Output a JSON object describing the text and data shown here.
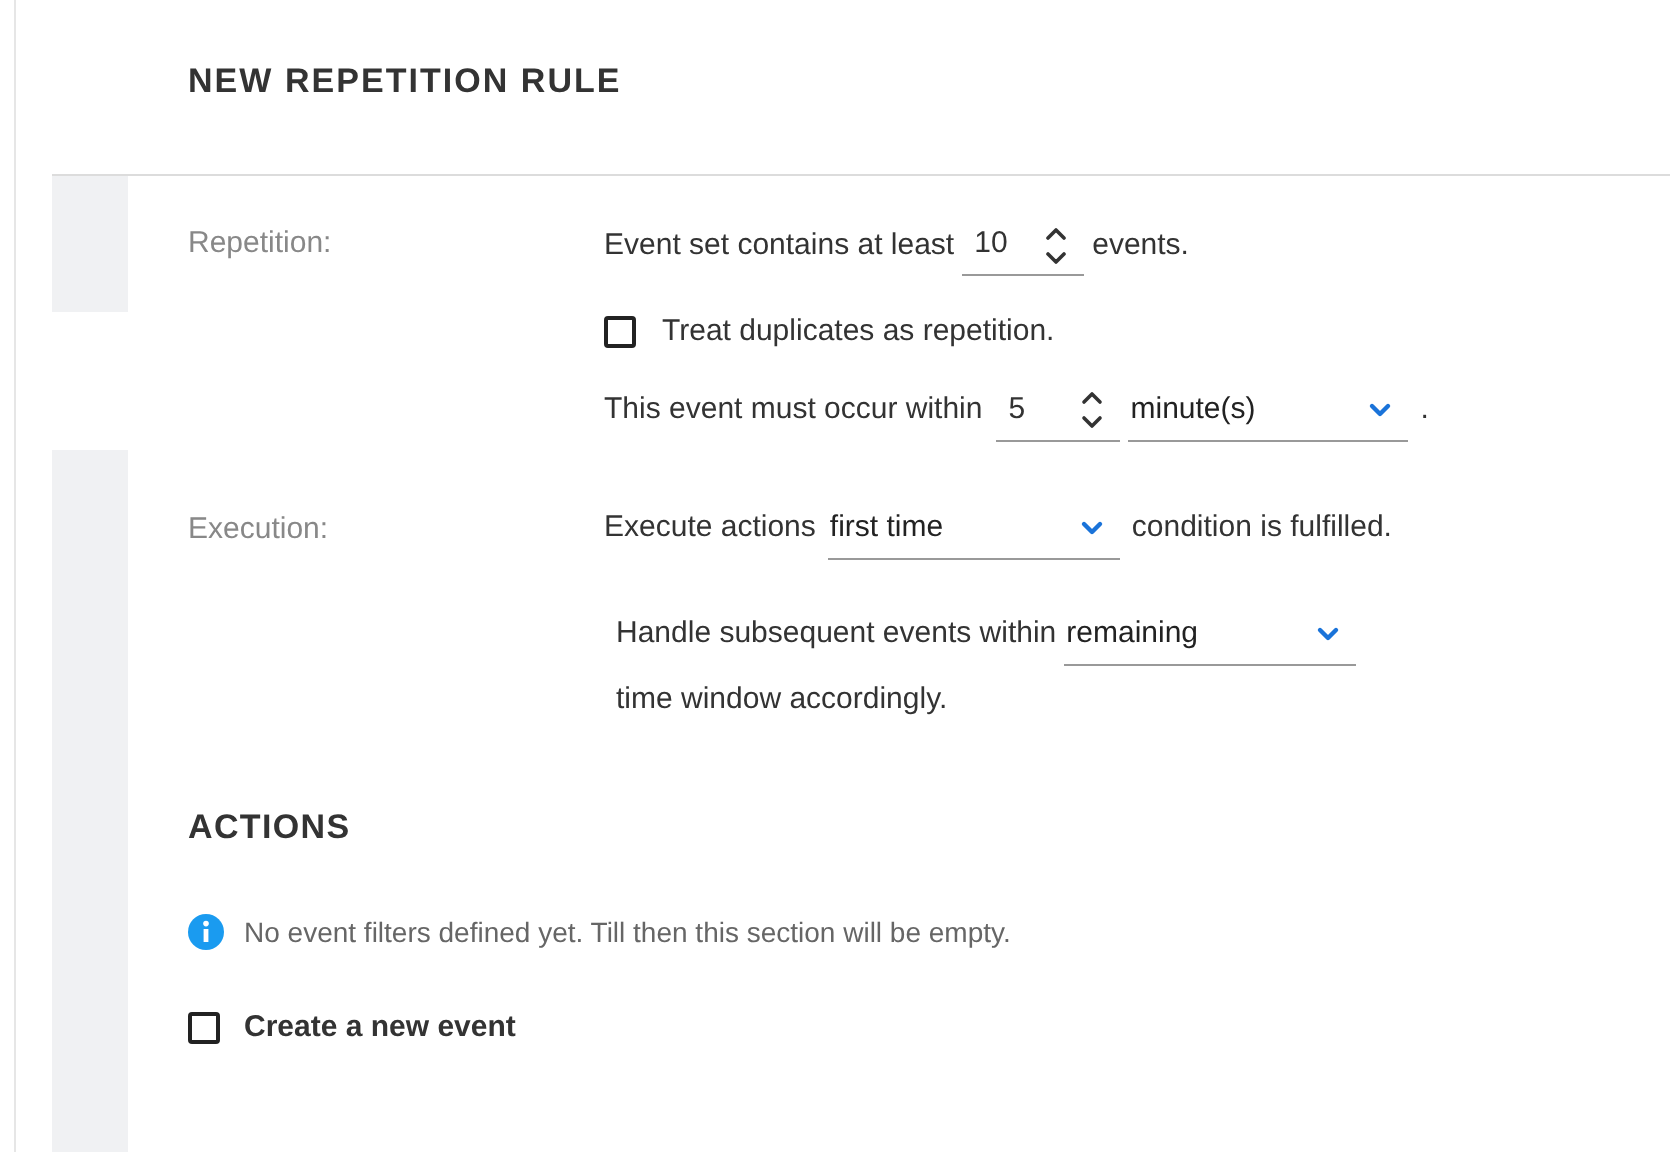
{
  "title": "NEW REPETITION RULE",
  "repetition": {
    "label": "Repetition:",
    "count_prefix": "Event set contains at least",
    "count": {
      "value": "10"
    },
    "count_suffix": "events.",
    "duplicates": {
      "label": "Treat duplicates as repetition.",
      "checked": false
    },
    "within_prefix": "This event must occur within",
    "within": {
      "value": "5"
    },
    "unit": {
      "value": "minute(s)"
    },
    "within_suffix": "."
  },
  "execution": {
    "label": "Execution:",
    "prefix": "Execute actions",
    "mode": {
      "value": "first time"
    },
    "suffix": "condition is fulfilled.",
    "handle_prefix": "Handle subsequent events within",
    "handle": {
      "value": "remaining"
    },
    "handle_suffix": "time window accordingly."
  },
  "actions": {
    "title": "ACTIONS",
    "info": "No event filters defined yet. Till then this section will be empty.",
    "create": {
      "label": "Create a new event",
      "checked": false
    }
  }
}
